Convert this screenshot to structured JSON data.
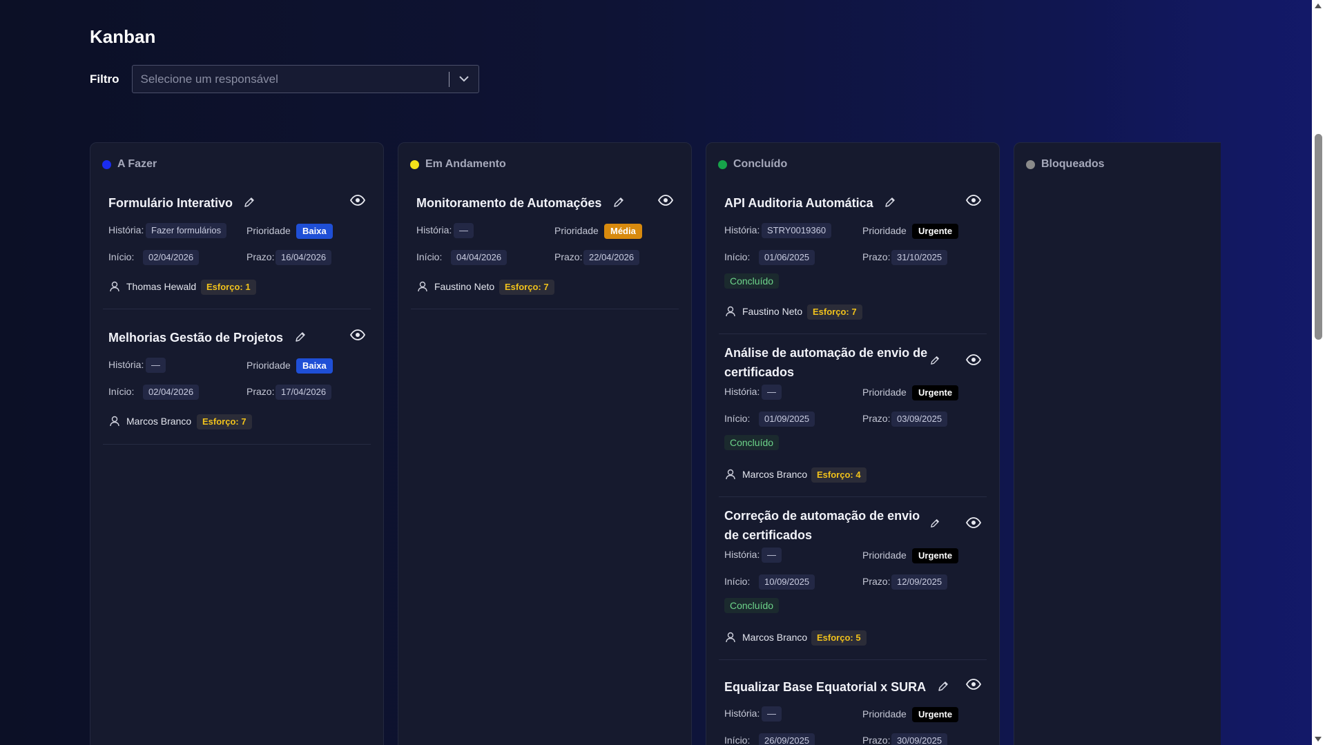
{
  "page": {
    "title": "Kanban"
  },
  "filter": {
    "label": "Filtro",
    "placeholder": "Selecione um responsável"
  },
  "labels": {
    "historia": "História:",
    "prioridade": "Prioridade",
    "inicio": "Início:",
    "prazo": "Prazo:"
  },
  "columns": [
    {
      "title": "A Fazer",
      "color": "#1a2cf0",
      "cards": [
        {
          "title": "Formulário Interativo",
          "historia": "Fazer formulários",
          "prioridade": "Baixa",
          "inicio": "02/04/2026",
          "prazo": "16/04/2026",
          "responsavel": "Thomas Hewald",
          "esforco": "Esforço: 1"
        },
        {
          "title": "Melhorias Gestão de Projetos",
          "historia": "—",
          "prioridade": "Baixa",
          "inicio": "02/04/2026",
          "prazo": "17/04/2026",
          "responsavel": "Marcos Branco",
          "esforco": "Esforço: 7"
        }
      ]
    },
    {
      "title": "Em Andamento",
      "color": "#f5e21a",
      "cards": [
        {
          "title": "Monitoramento de Automações",
          "historia": "—",
          "prioridade": "Média",
          "inicio": "04/04/2026",
          "prazo": "22/04/2026",
          "responsavel": "Faustino Neto",
          "esforco": "Esforço: 7"
        }
      ]
    },
    {
      "title": "Concluído",
      "color": "#16a34a",
      "cards": [
        {
          "title": "API Auditoria Automática",
          "historia": "STRY0019360",
          "prioridade": "Urgente",
          "inicio": "01/06/2025",
          "prazo": "31/10/2025",
          "status": "Concluído",
          "responsavel": "Faustino Neto",
          "esforco": "Esforço: 7"
        },
        {
          "title": "Análise de automação de envio de certificados",
          "historia": "—",
          "prioridade": "Urgente",
          "inicio": "01/09/2025",
          "prazo": "03/09/2025",
          "status": "Concluído",
          "responsavel": "Marcos Branco",
          "esforco": "Esforço: 4"
        },
        {
          "title": "Correção de automação de envio de certificados",
          "historia": "—",
          "prioridade": "Urgente",
          "inicio": "10/09/2025",
          "prazo": "12/09/2025",
          "status": "Concluído",
          "responsavel": "Marcos Branco",
          "esforco": "Esforço: 5"
        },
        {
          "title": "Equalizar Base Equatorial x SURA",
          "historia": "—",
          "prioridade": "Urgente",
          "inicio": "26/09/2025",
          "prazo": "30/09/2025"
        }
      ]
    },
    {
      "title": "Bloqueados",
      "color": "#8a8a8a",
      "cards": []
    }
  ],
  "colors": {
    "baixa": "#1f4fd6",
    "media": "#d88a0e",
    "urgente": "#000000",
    "esforco": "#f1c21b",
    "concluido": "#6dd48a"
  },
  "icons": [
    "pencil-icon",
    "eye-icon",
    "user-icon",
    "chevron-down-icon"
  ]
}
